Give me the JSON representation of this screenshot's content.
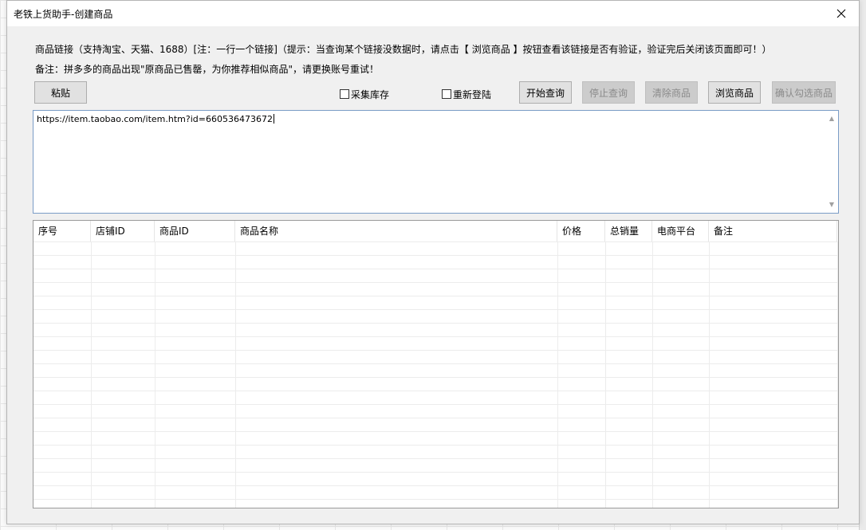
{
  "window": {
    "title": "老铁上货助手-创建商品"
  },
  "notes": {
    "line1": "商品链接（支持淘宝、天猫、1688）[注：一行一个链接]（提示：当查询某个链接没数据时，请点击【 浏览商品 】按钮查看该链接是否有验证，验证完后关闭该页面即可！）",
    "line2": "备注：拼多多的商品出现\"原商品已售罄，为你推荐相似商品\"，请更换账号重试！"
  },
  "toolbar": {
    "paste": "粘贴",
    "collect_stock": "采集库存",
    "relogin": "重新登陆",
    "start_query": "开始查询",
    "stop_query": "停止查询",
    "clear_items": "清除商品",
    "browse_items": "浏览商品",
    "confirm_selected": "确认勾选商品"
  },
  "url_input": {
    "value": "https://item.taobao.com/item.htm?id=660536473672"
  },
  "table": {
    "columns": [
      "序号",
      "店铺ID",
      "商品ID",
      "商品名称",
      "价格",
      "总销量",
      "电商平台",
      "备注"
    ],
    "rows": []
  }
}
